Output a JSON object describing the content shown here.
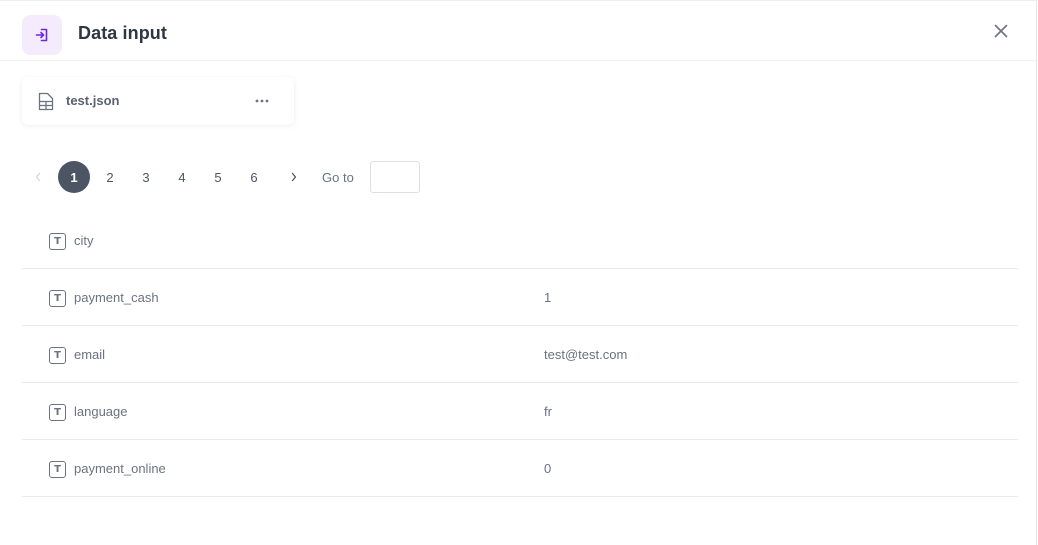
{
  "header": {
    "title": "Data input",
    "icon": "login-icon",
    "close_icon": "close-icon",
    "accent_color": "#6d28d9",
    "icon_bg_color": "#f4ebfd"
  },
  "file": {
    "name": "test.json",
    "icon": "table-file-icon",
    "menu_icon": "more-horizontal-icon"
  },
  "pagination": {
    "current_page": 1,
    "pages": [
      "1",
      "2",
      "3",
      "4",
      "5",
      "6"
    ],
    "prev_icon": "chevron-left-icon",
    "next_icon": "chevron-right-icon",
    "goto_label": "Go to",
    "goto_value": ""
  },
  "fields": [
    {
      "type": "T",
      "name": "city",
      "value": ""
    },
    {
      "type": "T",
      "name": "payment_cash",
      "value": "1"
    },
    {
      "type": "T",
      "name": "email",
      "value": "test@test.com"
    },
    {
      "type": "T",
      "name": "language",
      "value": "fr"
    },
    {
      "type": "T",
      "name": "payment_online",
      "value": "0"
    }
  ]
}
